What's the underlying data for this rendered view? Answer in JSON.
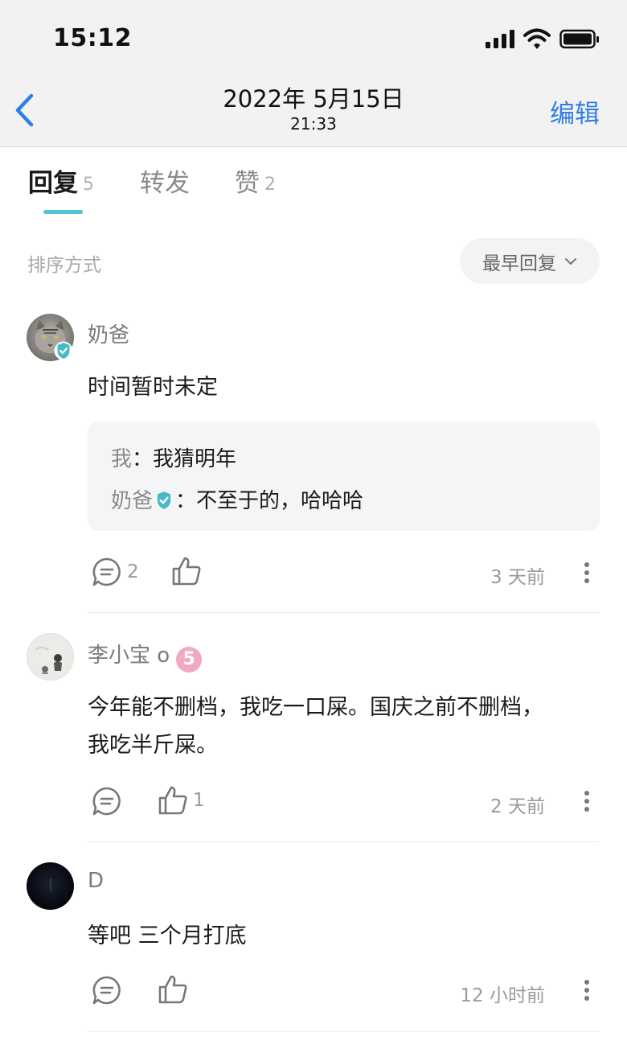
{
  "status_bar": {
    "time": "15:12"
  },
  "nav": {
    "title": "2022年 5月15日",
    "subtitle": "21:33",
    "edit_label": "编辑"
  },
  "tabs": [
    {
      "label": "回复",
      "count": "5",
      "active": true
    },
    {
      "label": "转发",
      "count": "",
      "active": false
    },
    {
      "label": "赞",
      "count": "2",
      "active": false
    }
  ],
  "sort": {
    "label": "排序方式",
    "selected": "最早回复"
  },
  "comments": [
    {
      "user": "奶爸",
      "verified": true,
      "text": "时间暂时未定",
      "replies": [
        {
          "name": "我",
          "separator": "：",
          "text": "我猜明年"
        },
        {
          "name": "奶爸",
          "separator": "：",
          "text": "不至于的，哈哈哈"
        }
      ],
      "reply_count": "2",
      "like_count": "",
      "time": "3 天前"
    },
    {
      "user": "李小宝 o",
      "level": "5",
      "text_lines": [
        "今年能不删档，我吃一口屎。国庆之前不删档，",
        "我吃半斤屎。"
      ],
      "reply_count": "",
      "like_count": "1",
      "time": "2 天前"
    },
    {
      "user": "D",
      "text": "等吧  三个月打底",
      "reply_count": "",
      "like_count": "",
      "time": "12 小时前"
    }
  ],
  "colors": {
    "accent_blue": "#2f7ee6",
    "tab_underline": "#4fc6cf",
    "verified": "#49b9c7",
    "level_badge": "#f2a7c3"
  }
}
